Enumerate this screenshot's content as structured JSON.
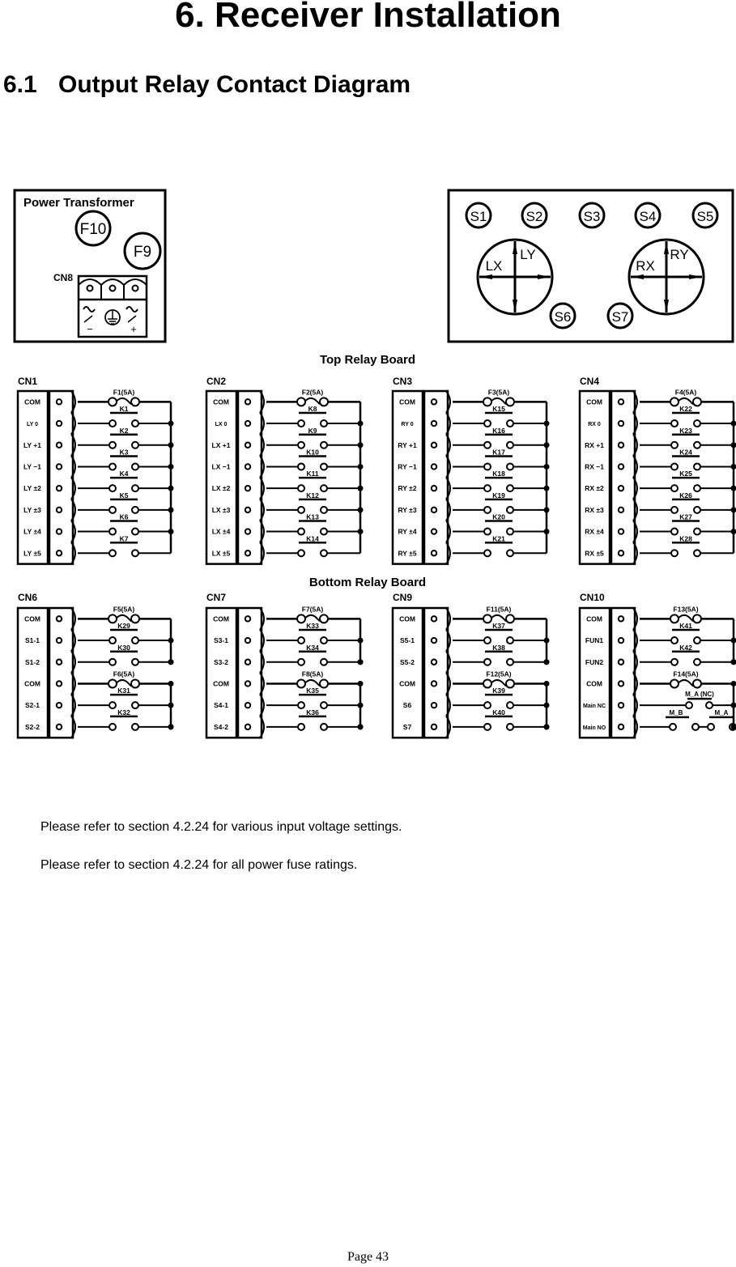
{
  "page": {
    "title": "6. Receiver Installation",
    "section_number": "6.1",
    "section_title": "Output Relay Contact Diagram",
    "notes": [
      "Please refer to section 4.2.24 for various input voltage settings.",
      "Please refer to section 4.2.24 for all power fuse ratings."
    ],
    "footer": "Page 43"
  },
  "power_transformer": {
    "title": "Power Transformer",
    "fuses": [
      "F10",
      "F9"
    ],
    "connector": "CN8",
    "terminal_symbols": [
      "ac-minus",
      "ground",
      "ac-plus"
    ],
    "terminal_marks": [
      "−",
      "+"
    ]
  },
  "transmitter_panel": {
    "switches_top": [
      "S1",
      "S2",
      "S3",
      "S4",
      "S5"
    ],
    "switches_bottom": [
      "S6",
      "S7"
    ],
    "joysticks": [
      {
        "name": "left",
        "x_label": "LX",
        "y_label": "LY"
      },
      {
        "name": "right",
        "x_label": "RX",
        "y_label": "RY"
      }
    ]
  },
  "boards": [
    {
      "title": "Top Relay Board",
      "connectors": [
        {
          "name": "CN1",
          "pins": [
            "COM",
            "LY   0",
            "LY +1",
            "LY −1",
            "LY ±2",
            "LY ±3",
            "LY ±4",
            "LY ±5"
          ],
          "fuses": [
            {
              "label": "F1(5A)",
              "pin": 0
            }
          ],
          "relays": [
            "K1",
            "K2",
            "K3",
            "K4",
            "K5",
            "K6",
            "K7"
          ]
        },
        {
          "name": "CN2",
          "pins": [
            "COM",
            "LX   0",
            "LX +1",
            "LX −1",
            "LX ±2",
            "LX ±3",
            "LX ±4",
            "LX ±5"
          ],
          "fuses": [
            {
              "label": "F2(5A)",
              "pin": 0
            }
          ],
          "relays": [
            "K8",
            "K9",
            "K10",
            "K11",
            "K12",
            "K13",
            "K14"
          ]
        },
        {
          "name": "CN3",
          "pins": [
            "COM",
            "RY   0",
            "RY +1",
            "RY −1",
            "RY ±2",
            "RY ±3",
            "RY ±4",
            "RY ±5"
          ],
          "fuses": [
            {
              "label": "F3(5A)",
              "pin": 0
            }
          ],
          "relays": [
            "K15",
            "K16",
            "K17",
            "K18",
            "K19",
            "K20",
            "K21"
          ]
        },
        {
          "name": "CN4",
          "pins": [
            "COM",
            "RX   0",
            "RX +1",
            "RX −1",
            "RX ±2",
            "RX ±3",
            "RX ±4",
            "RX ±5"
          ],
          "fuses": [
            {
              "label": "F4(5A)",
              "pin": 0
            }
          ],
          "relays": [
            "K22",
            "K23",
            "K24",
            "K25",
            "K26",
            "K27",
            "K28"
          ]
        }
      ]
    },
    {
      "title": "Bottom Relay Board",
      "connectors": [
        {
          "name": "CN6",
          "pins": [
            "COM",
            "S1-1",
            "S1-2",
            "COM",
            "S2-1",
            "S2-2"
          ],
          "fuses": [
            {
              "label": "F5(5A)",
              "pin": 0
            },
            {
              "label": "F6(5A)",
              "pin": 3
            }
          ],
          "relays": [
            "K29",
            "K30",
            "K31",
            "K32"
          ]
        },
        {
          "name": "CN7",
          "pins": [
            "COM",
            "S3-1",
            "S3-2",
            "COM",
            "S4-1",
            "S4-2"
          ],
          "fuses": [
            {
              "label": "F7(5A)",
              "pin": 0
            },
            {
              "label": "F8(5A)",
              "pin": 3
            }
          ],
          "relays": [
            "K33",
            "K34",
            "K35",
            "K36"
          ]
        },
        {
          "name": "CN9",
          "pins": [
            "COM",
            "S5-1",
            "S5-2",
            "COM",
            "S6",
            "S7"
          ],
          "fuses": [
            {
              "label": "F11(5A)",
              "pin": 0
            },
            {
              "label": "F12(5A)",
              "pin": 3
            }
          ],
          "relays": [
            "K37",
            "K38",
            "K39",
            "K40"
          ]
        },
        {
          "name": "CN10",
          "pins": [
            "COM",
            "FUN1",
            "FUN2",
            "COM",
            "Main NC",
            "Main NO"
          ],
          "fuses": [
            {
              "label": "F13(5A)",
              "pin": 0
            },
            {
              "label": "F14(5A)",
              "pin": 3
            }
          ],
          "relays": [
            "K41",
            "K42",
            "M_A  (NC)",
            "M_B",
            "M_A"
          ]
        }
      ]
    }
  ],
  "colors": {
    "ink": "#000000",
    "paper": "#ffffff"
  }
}
